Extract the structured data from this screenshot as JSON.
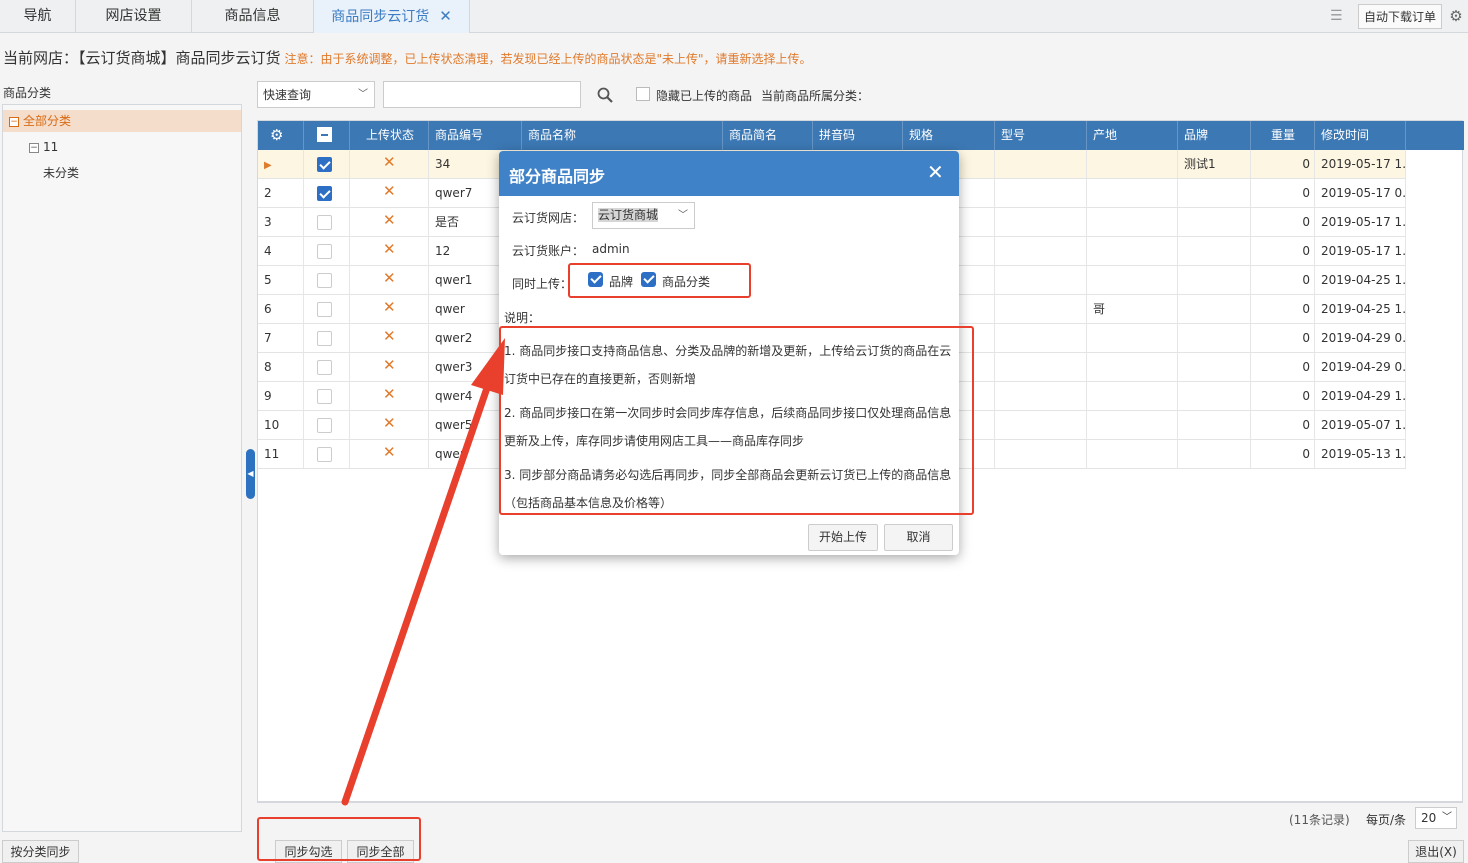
{
  "tabs": [
    {
      "label": "导航",
      "active": false
    },
    {
      "label": "网店设置",
      "active": false
    },
    {
      "label": "商品信息",
      "active": false
    },
    {
      "label": "商品同步云订货",
      "active": true
    }
  ],
  "topbar": {
    "auto_download": "自动下载订单",
    "list_icon": "list-icon",
    "gear_icon": "gear-icon"
  },
  "header": {
    "shop": "当前网店：【云订货商城】商品同步云订货",
    "note": "注意：由于系统调整，已上传状态清理，若发现已经上传的商品状态是\"未上传\"，请重新选择上传。"
  },
  "sidebar": {
    "title": "商品分类",
    "tree": [
      {
        "label": "全部分类",
        "toggle": "−"
      },
      {
        "label": "11",
        "toggle": "−"
      },
      {
        "label": "未分类",
        "toggle": ""
      }
    ],
    "sync_button": "按分类同步"
  },
  "search": {
    "quick": "快速查询",
    "hide_label": "隐藏已上传的商品",
    "cat_label": "当前商品所属分类："
  },
  "grid": {
    "columns": [
      "",
      "",
      "上传状态",
      "商品编号",
      "商品名称",
      "商品简名",
      "拼音码",
      "规格",
      "型号",
      "产地",
      "品牌",
      "重量",
      "修改时间"
    ],
    "rows": [
      {
        "no": "",
        "checked": true,
        "code": "34",
        "spec": "",
        "origin": "",
        "brand": "测试1",
        "weight": "0",
        "time": "2019-05-17 1..."
      },
      {
        "no": "2",
        "checked": true,
        "code": "qwer7",
        "spec": "",
        "origin": "",
        "brand": "",
        "weight": "0",
        "time": "2019-05-17 0..."
      },
      {
        "no": "3",
        "checked": false,
        "code": "是否",
        "spec": "",
        "origin": "",
        "brand": "",
        "weight": "0",
        "time": "2019-05-17 1..."
      },
      {
        "no": "4",
        "checked": false,
        "code": "12",
        "spec": "",
        "origin": "",
        "brand": "",
        "weight": "0",
        "time": "2019-05-17 1..."
      },
      {
        "no": "5",
        "checked": false,
        "code": "qwer1",
        "spec": "b",
        "origin": "",
        "brand": "",
        "weight": "0",
        "time": "2019-04-25 1..."
      },
      {
        "no": "6",
        "checked": false,
        "code": "qwer",
        "spec": "",
        "origin": "哥",
        "brand": "",
        "weight": "0",
        "time": "2019-04-25 1..."
      },
      {
        "no": "7",
        "checked": false,
        "code": "qwer2",
        "spec": "",
        "origin": "",
        "brand": "",
        "weight": "0",
        "time": "2019-04-29 0..."
      },
      {
        "no": "8",
        "checked": false,
        "code": "qwer3",
        "spec": "",
        "origin": "",
        "brand": "",
        "weight": "0",
        "time": "2019-04-29 0..."
      },
      {
        "no": "9",
        "checked": false,
        "code": "qwer4",
        "spec": "",
        "origin": "",
        "brand": "",
        "weight": "0",
        "time": "2019-04-29 1..."
      },
      {
        "no": "10",
        "checked": false,
        "code": "qwer5",
        "spec": "",
        "origin": "",
        "brand": "",
        "weight": "0",
        "time": "2019-05-07 1..."
      },
      {
        "no": "11",
        "checked": false,
        "code": "qwer",
        "spec": "",
        "origin": "",
        "brand": "",
        "weight": "0",
        "time": "2019-05-13 1..."
      }
    ],
    "row_arrow": "▶",
    "x_mark": "✕"
  },
  "pager": {
    "count": "(11条记录)",
    "per_page": "每页/条",
    "size": "20"
  },
  "bottom": {
    "sync_selected": "同步勾选",
    "sync_all": "同步全部",
    "exit": "退出(X)"
  },
  "dialog": {
    "title": "部分商品同步",
    "close": "✕",
    "shop_label": "云订货网店：",
    "shop_value": "云订货商城",
    "account_label": "云订货账户：",
    "account_value": "admin",
    "upload_label": "同时上传：",
    "opt_brand": "品牌",
    "opt_category": "商品分类",
    "desc_title": "说明：",
    "desc": [
      "1. 商品同步接口支持商品信息、分类及品牌的新增及更新，上传给云订货的商品在云",
      "订货中已存在的直接更新，否则新增",
      "2. 商品同步接口在第一次同步时会同步库存信息，后续商品同步接口仅处理商品信息",
      "更新及上传，库存同步请使用网店工具——商品库存同步",
      "3. 同步部分商品请务必勾选后再同步，同步全部商品会更新云订货已上传的商品信息",
      "（包括商品基本信息及价格等）"
    ],
    "start": "开始上传",
    "cancel": "取消"
  },
  "colors": {
    "accent": "#3c78b4",
    "warn": "#e07a2c",
    "annotation": "#e8402d"
  }
}
